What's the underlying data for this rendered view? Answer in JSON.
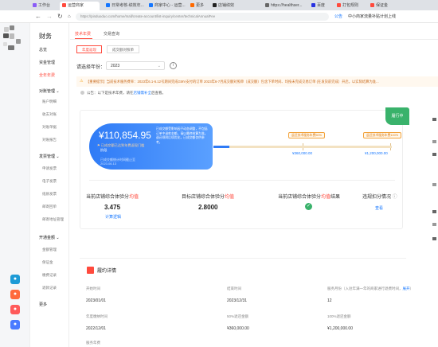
{
  "browser": {
    "tabs": [
      {
        "label": "工作台",
        "color": "#8a5cf6"
      },
      {
        "label": "运营商家",
        "color": "#ff4a3d"
      },
      {
        "label": "日常考核-绩效年...",
        "color": "#1677ff"
      },
      {
        "label": "商家中心 - 运营...",
        "color": "#1677ff"
      },
      {
        "label": "更多",
        "color": "#ff6a00"
      },
      {
        "label": "店铺绩效",
        "color": "#222222"
      },
      {
        "label": "https://healthser...",
        "color": "#666666"
      },
      {
        "label": "百度",
        "color": "#2932e1"
      },
      {
        "label": "打包规则",
        "color": "#ff4a3d"
      },
      {
        "label": "保证金",
        "color": "#ff4a3d"
      }
    ],
    "url": "https://pinduoduo.com/home/mall/create-account/list-inquiry/center/technicalAnnualFee",
    "shop_tag": "公告",
    "shop_name": "中小商家流量补贴计划上线"
  },
  "sidebar": {
    "title": "财务",
    "items_top": [
      "总览",
      "资金管理",
      "全年年费"
    ],
    "active_index": 2,
    "group1": {
      "label": "对账管理",
      "items": [
        "账户明细",
        "收支对账",
        "对账单据",
        "对账报告"
      ]
    },
    "group2": {
      "label": "发票管理",
      "items": [
        "申请发票",
        "电子发票",
        "纸质发票",
        "邮寄回单",
        "邮寄地址管理"
      ]
    },
    "group3": {
      "label": "开通金额",
      "items": [
        "金额管理",
        "保证金",
        "缴费记录",
        "退款记录"
      ]
    },
    "more": "更多"
  },
  "page_tabs": [
    "技术年费",
    "交易查询"
  ],
  "sub_tabs": [
    "年度返现",
    "成交额对照单"
  ],
  "year": {
    "label": "请选择年份：",
    "value": "2023"
  },
  "notice": {
    "text": "【重要提示】当前技术服务费率：2023年6.1-6.12号期间完成GMV支付的订单 2023年6-7月成交额对照单（成交额）包含下单时间、均按未完成交易订单 (在发货前完成）开启，以实际结算为准...",
    "info_prefix": "公告：以下是技术年费，请在",
    "info_link": "店铺需补全",
    "info_suffix": "后查看。"
  },
  "summary": {
    "amount": "¥110,854.95",
    "desc": "已成交额已达到年费返现门槛",
    "desc2": "阶段",
    "date_line": "已成交额统计时间截止至",
    "date": "2023.06.13",
    "note": "已成交额受影响因子动态调整，不包括订单中退款金额，请以最终结算为准。退还规则后续优化，已成交额仅供参考。",
    "ribbon": "履行中"
  },
  "tiers": [
    {
      "label": "返还技术服务年费50%",
      "value": "¥360,000.00"
    },
    {
      "label": "返还技术服务年费100%",
      "value": "¥1,200,000.00"
    }
  ],
  "progress_pct": 9,
  "metrics": [
    {
      "label_pre": "当前店铺综合体验分",
      "label_red": "均值",
      "value": "3.475",
      "link": "计算逻辑"
    },
    {
      "label_pre": "目标店铺综合体验分",
      "label_red": "均值",
      "value": "2.8000",
      "link": ""
    },
    {
      "label_pre": "当前店铺综合体验分",
      "label_red": "均值",
      "label_post": "结果",
      "value": "",
      "link": ""
    },
    {
      "label_pre": "违规扣分情况",
      "label_red": "",
      "value": "",
      "link": "查看"
    }
  ],
  "contract": {
    "title": "履约详情",
    "fields": [
      {
        "label": "开始时间",
        "value": "2023/01/01"
      },
      {
        "label": "结束时间",
        "value": "2023/12/31"
      },
      {
        "label": "服务月份（入驻年满一年的商家进行退费时间，",
        "link": "展开",
        "label_end": "）",
        "value": "12"
      },
      {
        "label": "年度缴纳时间",
        "value": "2022/12/01"
      },
      {
        "label": "50%退还金额",
        "value": "¥360,000.00"
      },
      {
        "label": "100%退还金额",
        "value": "¥1,200,000.00"
      }
    ],
    "footer_label": "服务年费"
  }
}
